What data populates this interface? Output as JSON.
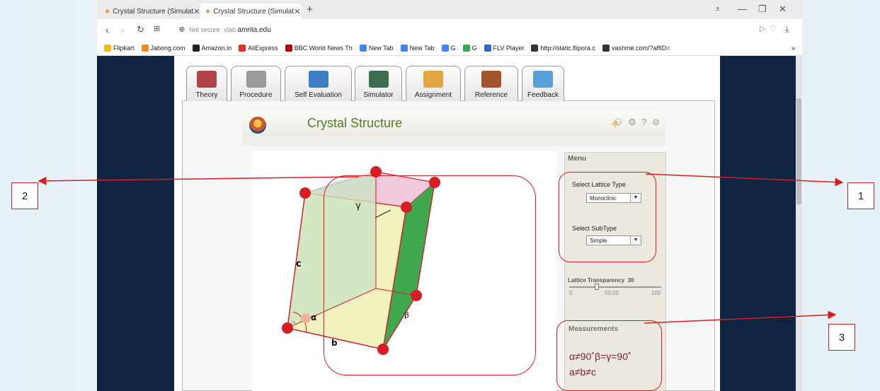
{
  "browser": {
    "tabs": [
      {
        "title": "Crystal Structure (Simulat"
      },
      {
        "title": "Crystal Structure (Simulat"
      }
    ],
    "new_tab_symbol": "+",
    "url_security": "Not secure",
    "url_host_prefix": "vlab.",
    "url_domain": "amrita.edu",
    "bookmarks": [
      {
        "label": "Flipkart",
        "color": "#f5b916"
      },
      {
        "label": "Jabong.com",
        "color": "#f08a1c"
      },
      {
        "label": "Amazon.in",
        "color": "#222222"
      },
      {
        "label": "AliExpress",
        "color": "#e43225"
      },
      {
        "label": "BBC World News Th",
        "color": "#b80000"
      },
      {
        "label": "New Tab",
        "color": "#4285f4"
      },
      {
        "label": "New Tab",
        "color": "#4285f4"
      },
      {
        "label": "G",
        "color": "#4285f4"
      },
      {
        "label": "G",
        "color": "#34a853"
      },
      {
        "label": "FLV Player",
        "color": "#3366cc"
      },
      {
        "label": "http://static.flipora.c",
        "color": "#333333"
      },
      {
        "label": "vashme.com/?affID=",
        "color": "#333333"
      }
    ],
    "more_bookmarks": "»"
  },
  "lab_tabs": [
    {
      "label": "Theory",
      "color": "#b0444a"
    },
    {
      "label": "Procedure",
      "color": "#9a9a9a"
    },
    {
      "label": "Self Evaluation",
      "color": "#3d7fc4"
    },
    {
      "label": "Simulator",
      "color": "#3b6d4e"
    },
    {
      "label": "Assignment",
      "color": "#e0a640"
    },
    {
      "label": "Reference",
      "color": "#a5552e"
    },
    {
      "label": "Feedback",
      "color": "#5aa0d8"
    }
  ],
  "simulator": {
    "title": "Crystal Structure",
    "header_icons": "⚇ ⚙ ? ⊜"
  },
  "menu": {
    "title": "Menu",
    "lattice_label": "Select Lattice Type",
    "lattice_value": "Monoclinic",
    "subtype_label": "Select SubType",
    "subtype_value": "Simple",
    "transparency_label": "Lattice Transparency",
    "transparency_value": "30",
    "slider_min": "0",
    "slider_mid": "50.00",
    "slider_max": "100",
    "transparency_fraction": 0.3
  },
  "measurements": {
    "title": "Measurements",
    "angles": "α≠90˚β=γ=90˚",
    "lengths": "a≠b≠c"
  },
  "lattice_labels": {
    "gamma": "γ",
    "c": "c",
    "a": "a",
    "alpha": "α",
    "b": "b",
    "beta": "β"
  },
  "callouts": {
    "one": "1",
    "two": "2",
    "three": "3"
  },
  "colors": {
    "annotation_red": "#d61e1e",
    "atom_red": "#d81e25",
    "page_navy": "#0f2440",
    "title_green": "#567a2a"
  }
}
